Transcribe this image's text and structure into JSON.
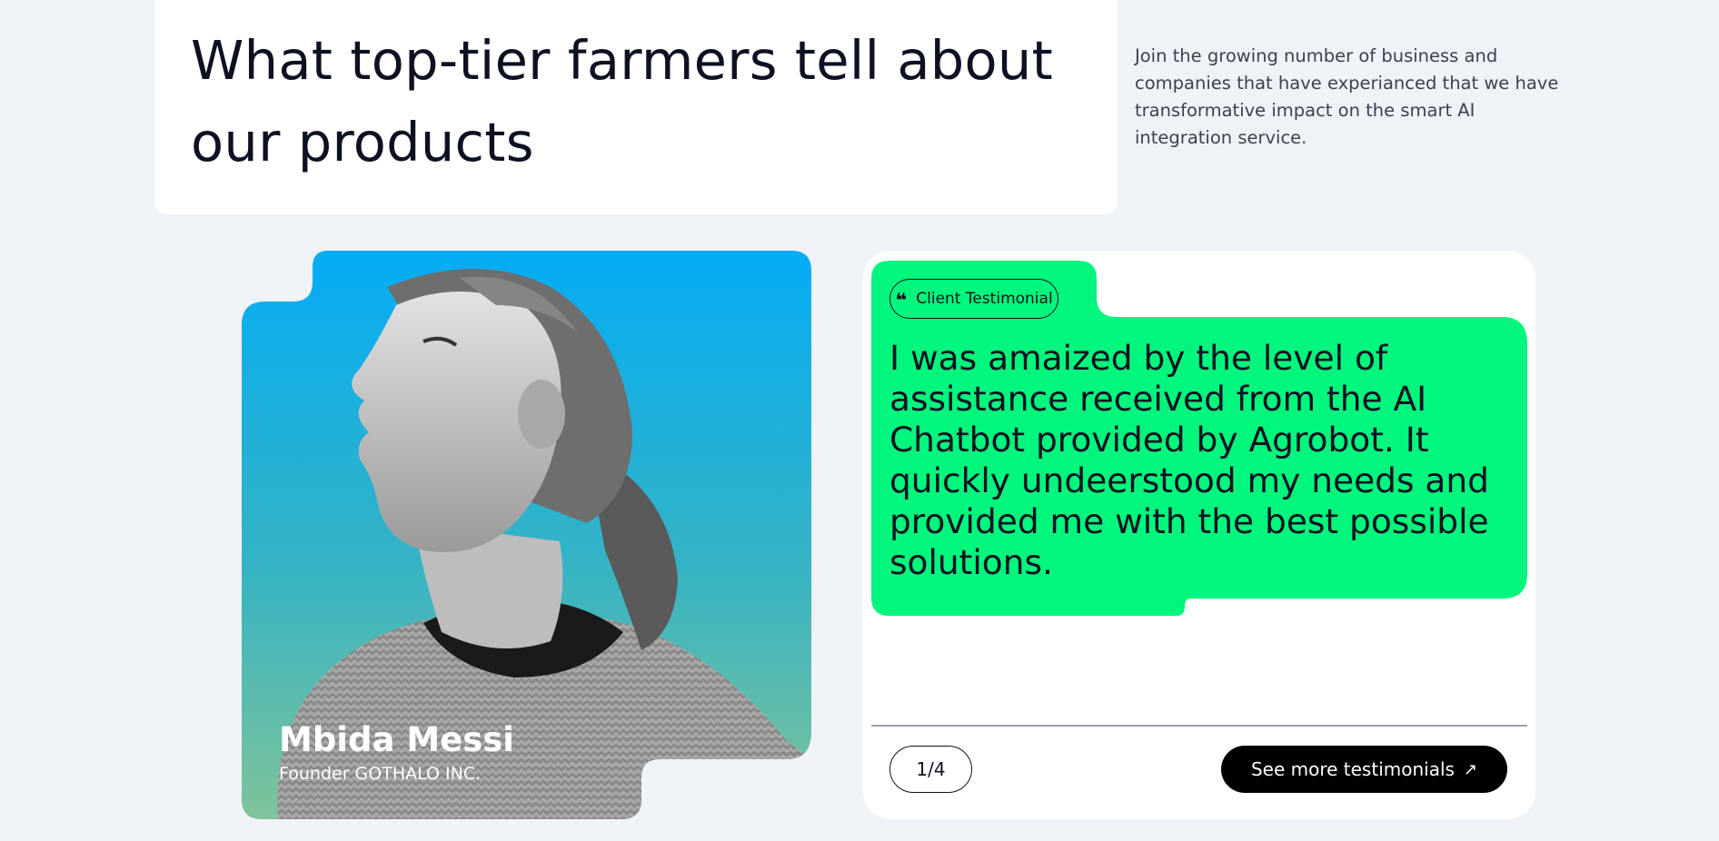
{
  "header": {
    "headline": "What top-tier farmers tell about our products",
    "intro": "Join the growing number of business and companies that have experianced that we have transformative impact on the smart AI integration service."
  },
  "person": {
    "name": "Mbida Messi",
    "role": "Founder GOTHALO INC."
  },
  "testimonial": {
    "tag_label": "Client Testimonial",
    "tag_icon": "quote-icon",
    "quote": "I was amaized by the level of assistance received from the AI Chatbot provided by Agrobot. It quickly undeerstood my needs and provided me with the best possible solutions.",
    "counter": "1/4",
    "button_label": "See more testimonials",
    "button_icon": "arrow-up-right-icon"
  },
  "colors": {
    "page_bg": "#eff2f7",
    "bubble_green": "#00f67c",
    "photo_gradient_top": "#05acf5",
    "photo_gradient_bottom": "#6fc8a4",
    "button_bg": "#000000"
  }
}
